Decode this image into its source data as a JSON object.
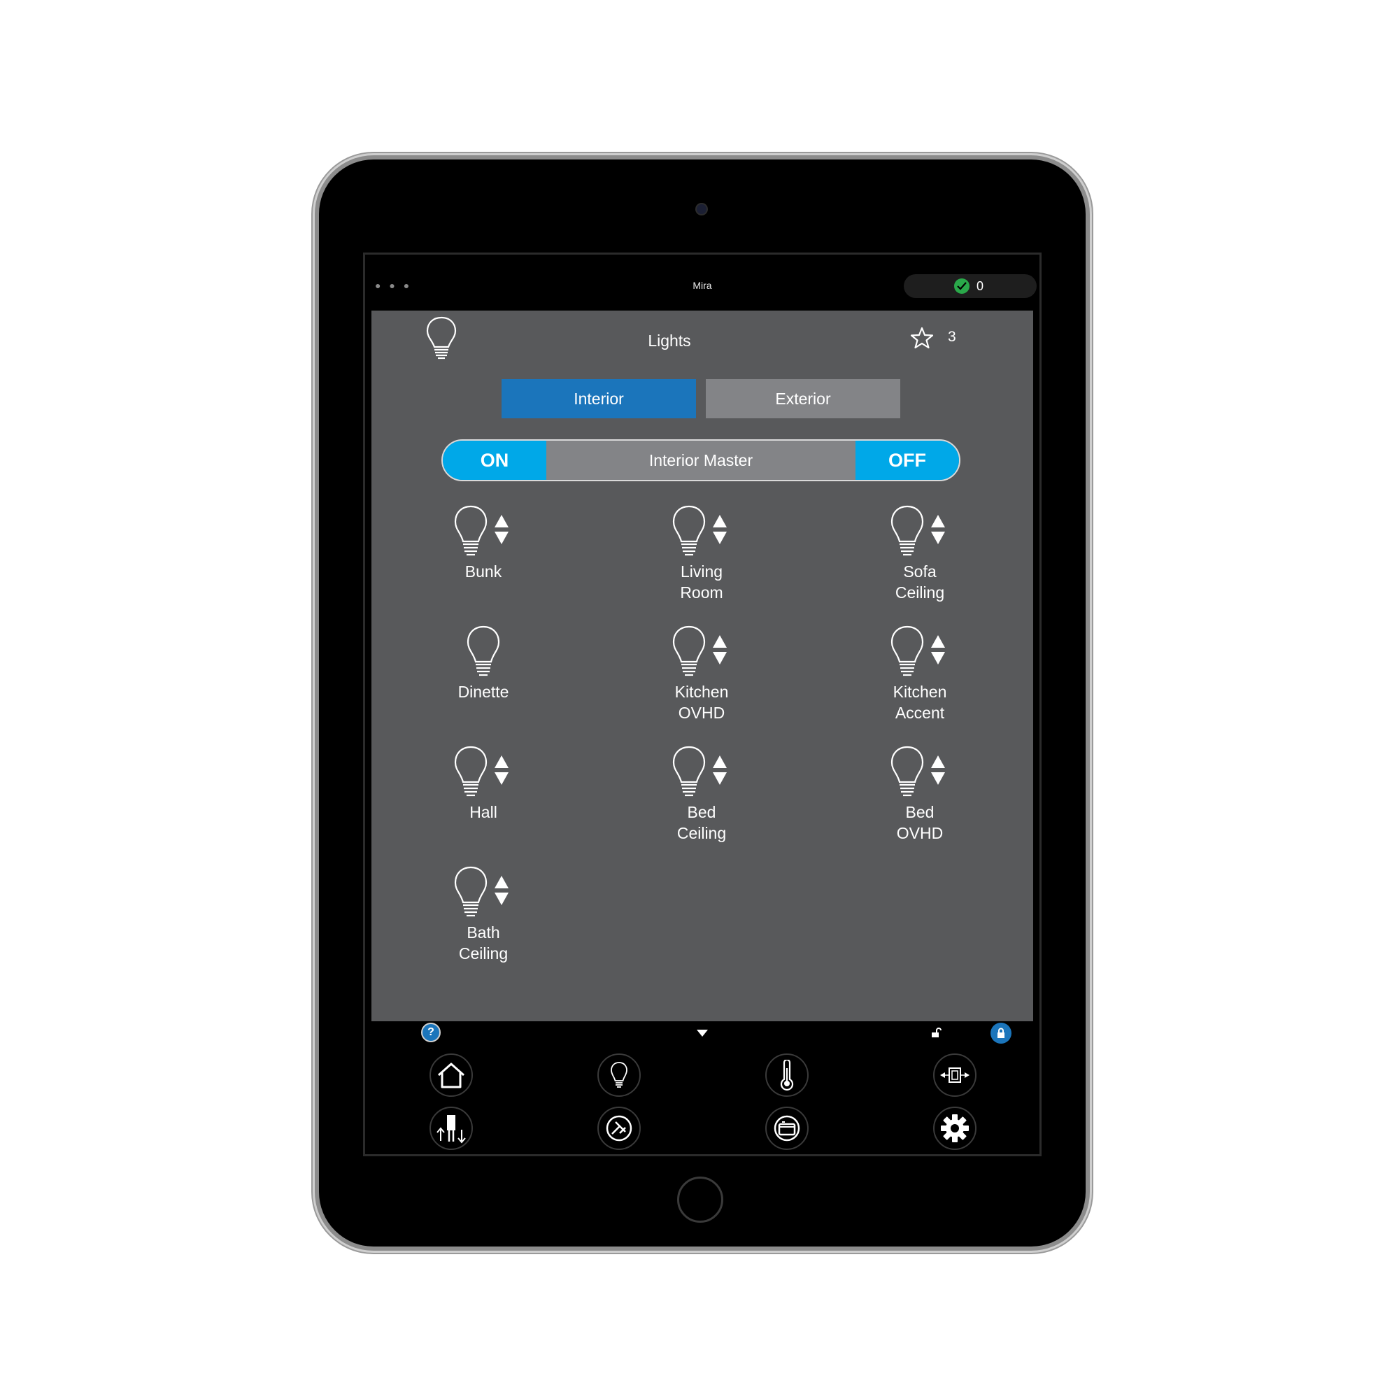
{
  "app": {
    "title": "Mira",
    "status_count": "0"
  },
  "header": {
    "title": "Lights",
    "favorites_count": "3",
    "icon": "lightbulb-icon"
  },
  "tabs": [
    {
      "label": "Interior",
      "active": true,
      "color": "#1b75bb"
    },
    {
      "label": "Exterior",
      "active": false,
      "color": "#838487"
    }
  ],
  "master": {
    "on_label": "ON",
    "label": "Interior Master",
    "off_label": "OFF",
    "accent": "#00a8e8"
  },
  "lights": [
    {
      "label_lines": [
        "Bunk"
      ],
      "dimmable": true
    },
    {
      "label_lines": [
        "Living",
        "Room"
      ],
      "dimmable": true
    },
    {
      "label_lines": [
        "Sofa",
        "Ceiling"
      ],
      "dimmable": true
    },
    {
      "label_lines": [
        "Dinette"
      ],
      "dimmable": false
    },
    {
      "label_lines": [
        "Kitchen",
        "OVHD"
      ],
      "dimmable": true
    },
    {
      "label_lines": [
        "Kitchen",
        "Accent"
      ],
      "dimmable": true
    },
    {
      "label_lines": [
        "Hall"
      ],
      "dimmable": true
    },
    {
      "label_lines": [
        "Bed",
        "Ceiling"
      ],
      "dimmable": true
    },
    {
      "label_lines": [
        "Bed",
        "OVHD"
      ],
      "dimmable": true
    },
    {
      "label_lines": [
        "Bath",
        "Ceiling"
      ],
      "dimmable": true
    }
  ],
  "utility_bar": {
    "help_label": "?"
  },
  "nav": [
    {
      "icon": "home-icon"
    },
    {
      "icon": "lightbulb-icon"
    },
    {
      "icon": "thermometer-icon"
    },
    {
      "icon": "slide-out-icon"
    },
    {
      "icon": "leveling-jacks-icon"
    },
    {
      "icon": "generator-icon"
    },
    {
      "icon": "tank-icon"
    },
    {
      "icon": "gear-icon"
    }
  ],
  "colors": {
    "panel": "#58595b",
    "status_ok": "#2aa84a"
  }
}
